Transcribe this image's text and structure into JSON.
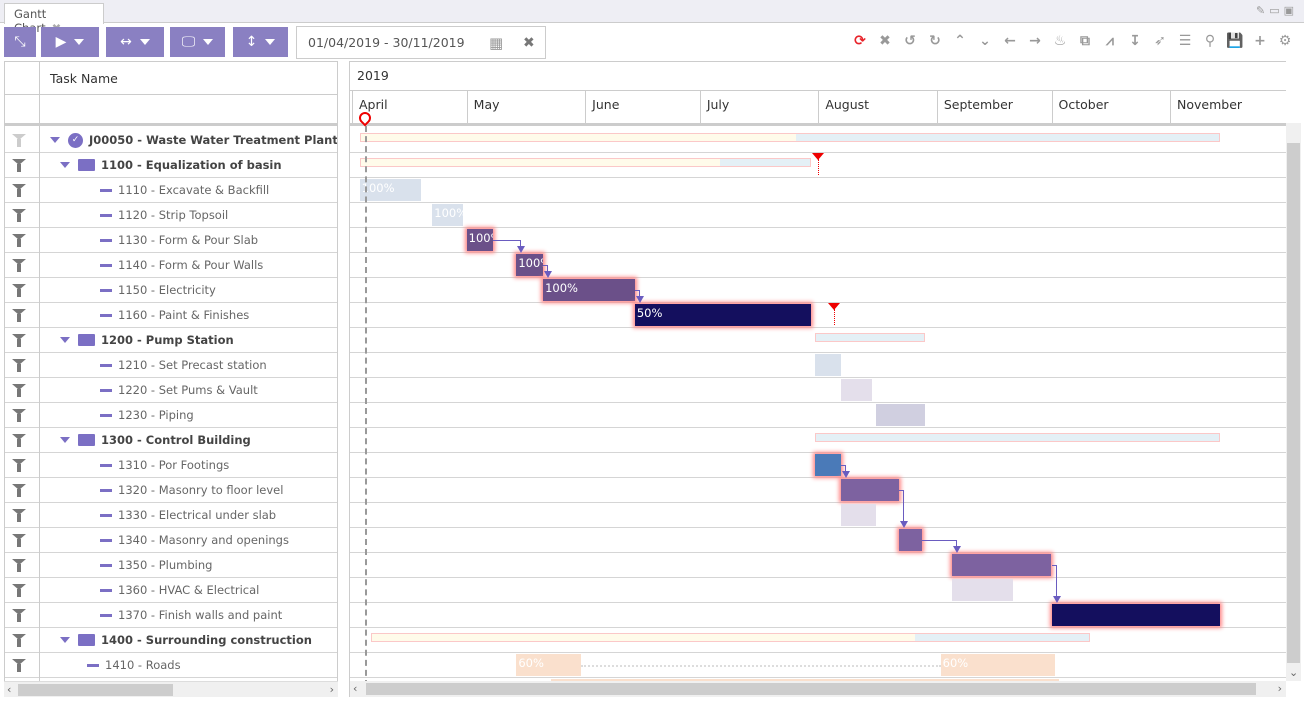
{
  "tab": {
    "title": "Gantt Chart",
    "close": "✖"
  },
  "toolbar": {
    "buttons": [
      {
        "name": "collapse-button",
        "icon": "compress-icon",
        "glyph": "⤡"
      },
      {
        "name": "play-button",
        "icon": "play-icon",
        "glyph": "▶"
      },
      {
        "name": "width-button",
        "icon": "arrows-horizontal-icon",
        "glyph": "↔"
      },
      {
        "name": "display-button",
        "icon": "monitor-icon",
        "glyph": "🖵"
      },
      {
        "name": "height-button",
        "icon": "arrows-vertical-icon",
        "glyph": "↕"
      }
    ],
    "date_range": "01/04/2019 - 30/11/2019",
    "calendar_glyph": "▦",
    "clear_glyph": "✖",
    "right_icons": [
      {
        "name": "refresh-icon",
        "glyph": "⟳",
        "color": "#e8232a"
      },
      {
        "name": "delete-icon",
        "glyph": "✖"
      },
      {
        "name": "undo-icon",
        "glyph": "↺"
      },
      {
        "name": "redo-icon",
        "glyph": "↻"
      },
      {
        "name": "collapse-all-icon",
        "glyph": "⌃"
      },
      {
        "name": "expand-all-icon",
        "glyph": "⌄"
      },
      {
        "name": "arrow-left-icon",
        "glyph": "←"
      },
      {
        "name": "arrow-right-icon",
        "glyph": "→"
      },
      {
        "name": "critical-path-icon",
        "glyph": "♨"
      },
      {
        "name": "fit-icon",
        "glyph": "⧉"
      },
      {
        "name": "chart-icon",
        "glyph": "⩘"
      },
      {
        "name": "indent-icon",
        "glyph": "↧"
      },
      {
        "name": "rocket-icon",
        "glyph": "➶"
      },
      {
        "name": "list-icon",
        "glyph": "☰"
      },
      {
        "name": "search-icon",
        "glyph": "⚲"
      },
      {
        "name": "save-icon",
        "glyph": "💾"
      },
      {
        "name": "add-icon",
        "glyph": "+"
      },
      {
        "name": "settings-icon",
        "glyph": "⚙"
      }
    ]
  },
  "grid": {
    "column_header": "Task Name"
  },
  "timeline": {
    "year": "2019",
    "months": [
      "April",
      "May",
      "June",
      "July",
      "August",
      "September",
      "October",
      "November"
    ],
    "start": "2019-04-01",
    "today": "2019-04-04"
  },
  "tasks": [
    {
      "name": "J00050 - Waste Water Treatment Plant",
      "type": "project",
      "bar": {
        "kind": "summary",
        "start": "2019-04-03",
        "end": "2019-11-14",
        "progress_to": "2019-07-26"
      }
    },
    {
      "name": "1100 - Equalization of basin",
      "type": "group",
      "bar": {
        "kind": "summary",
        "start": "2019-04-03",
        "end": "2019-07-30",
        "progress_to": "2019-07-06",
        "deadline": "2019-08-01"
      }
    },
    {
      "name": "1110 - Excavate & Backfill",
      "type": "task",
      "bar": {
        "kind": "faded",
        "start": "2019-04-03",
        "end": "2019-04-19",
        "label": "100%"
      }
    },
    {
      "name": "1120 - Strip Topsoil",
      "type": "task",
      "bar": {
        "kind": "faded",
        "start": "2019-04-22",
        "end": "2019-04-30",
        "label": "100%"
      }
    },
    {
      "name": "1130 - Form & Pour Slab",
      "type": "task",
      "bar": {
        "kind": "done",
        "start": "2019-05-01",
        "end": "2019-05-08",
        "label": "100%"
      }
    },
    {
      "name": "1140 - Form & Pour Walls",
      "type": "task",
      "bar": {
        "kind": "done",
        "start": "2019-05-14",
        "end": "2019-05-21",
        "label": "100%"
      }
    },
    {
      "name": "1150 - Electricity",
      "type": "task",
      "bar": {
        "kind": "done",
        "start": "2019-05-21",
        "end": "2019-06-14",
        "label": "100%"
      }
    },
    {
      "name": "1160 - Paint & Finishes",
      "type": "task",
      "bar": {
        "kind": "dark",
        "start": "2019-06-14",
        "end": "2019-07-30",
        "label": "50%",
        "deadline": "2019-08-05"
      }
    },
    {
      "name": "1200 - Pump Station",
      "type": "group",
      "bar": {
        "kind": "summary",
        "start": "2019-07-31",
        "end": "2019-08-29"
      }
    },
    {
      "name": "1210 - Set Precast station",
      "type": "task",
      "bar": {
        "kind": "faded",
        "start": "2019-07-31",
        "end": "2019-08-07"
      }
    },
    {
      "name": "1220 - Set Pums & Vault",
      "type": "task",
      "bar": {
        "kind": "light",
        "start": "2019-08-07",
        "end": "2019-08-15"
      }
    },
    {
      "name": "1230 - Piping",
      "type": "task",
      "bar": {
        "kind": "lightgrey",
        "start": "2019-08-16",
        "end": "2019-08-29"
      }
    },
    {
      "name": "1300 - Control Building",
      "type": "group",
      "bar": {
        "kind": "summary",
        "start": "2019-07-31",
        "end": "2019-11-14"
      }
    },
    {
      "name": "1310 - Por Footings",
      "type": "task",
      "bar": {
        "kind": "blue",
        "start": "2019-07-31",
        "end": "2019-08-07"
      }
    },
    {
      "name": "1320 - Masonry to floor level",
      "type": "task",
      "bar": {
        "kind": "prog",
        "start": "2019-08-07",
        "end": "2019-08-22"
      }
    },
    {
      "name": "1330 - Electrical under slab",
      "type": "task",
      "bar": {
        "kind": "light",
        "start": "2019-08-07",
        "end": "2019-08-16"
      }
    },
    {
      "name": "1340 - Masonry and openings",
      "type": "task",
      "bar": {
        "kind": "prog",
        "start": "2019-08-22",
        "end": "2019-08-28"
      }
    },
    {
      "name": "1350 - Plumbing",
      "type": "task",
      "bar": {
        "kind": "prog",
        "start": "2019-09-05",
        "end": "2019-10-01"
      }
    },
    {
      "name": "1360 - HVAC & Electrical",
      "type": "task",
      "bar": {
        "kind": "light",
        "start": "2019-09-05",
        "end": "2019-09-21"
      }
    },
    {
      "name": "1370 - Finish walls and paint",
      "type": "task",
      "bar": {
        "kind": "dark",
        "start": "2019-10-01",
        "end": "2019-11-14"
      }
    },
    {
      "name": "1400 - Surrounding construction",
      "type": "group",
      "bar": {
        "kind": "summary",
        "start": "2019-04-06",
        "end": "2019-10-11",
        "progress_to": "2019-08-26"
      }
    },
    {
      "name": "1410 - Roads",
      "type": "subtask",
      "bar": {
        "kind": "peach",
        "start": "2019-05-14",
        "end": "2019-05-31",
        "label": "60%",
        "split_start": "2019-09-02",
        "split_end": "2019-10-02",
        "split_label": "60%"
      }
    },
    {
      "name": "",
      "type": "task",
      "bar": {
        "kind": "peach",
        "start": "2019-05-23",
        "end": "2019-10-03"
      }
    }
  ],
  "links": [
    [
      4,
      5
    ],
    [
      5,
      6
    ],
    [
      6,
      7
    ],
    [
      13,
      14
    ],
    [
      14,
      16
    ],
    [
      16,
      17
    ],
    [
      17,
      19
    ]
  ],
  "colors": {
    "accent": "#8a80c2",
    "tree_icon": "#7b6fc4",
    "deadline": "#e00000"
  }
}
